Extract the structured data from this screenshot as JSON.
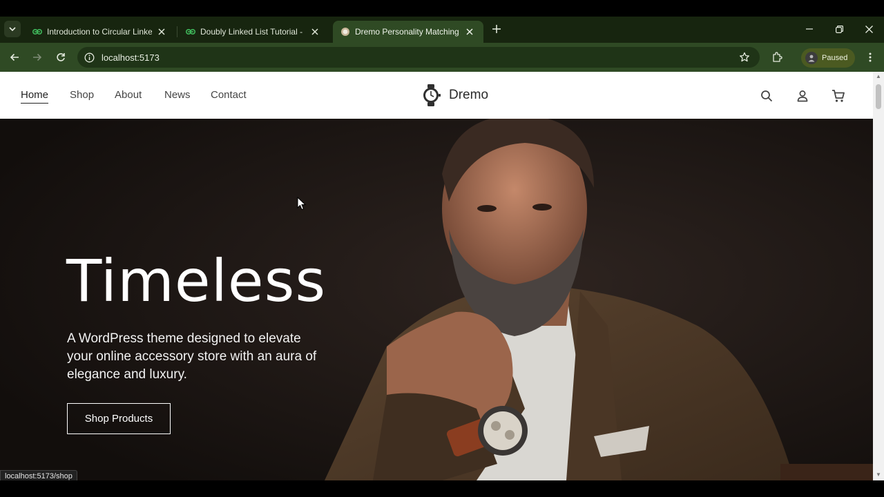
{
  "browser": {
    "tabs": [
      {
        "title": "Introduction to Circular Linked",
        "active": false
      },
      {
        "title": "Doubly Linked List Tutorial - Ge",
        "active": false
      },
      {
        "title": "Dremo Personality Matching W",
        "active": true
      }
    ],
    "url": "localhost:5173",
    "profile_label": "Paused",
    "status_url": "localhost:5173/shop"
  },
  "site": {
    "nav": [
      "Home",
      "Shop",
      "About",
      "News",
      "Contact"
    ],
    "brand_name": "Dremo",
    "hero": {
      "title": "Timeless",
      "subtitle": "A WordPress theme designed to elevate your online accessory store with an aura of elegance and luxury.",
      "cta": "Shop Products"
    }
  },
  "colors": {
    "tabstrip": "#17250f",
    "toolbar": "#2f4a24",
    "hero_bg": "#181311"
  },
  "icons": [
    "tab-list-icon",
    "favicon-gfg-icon",
    "favicon-watch-icon",
    "close-icon",
    "plus-icon",
    "minimize-icon",
    "restore-icon",
    "window-close-icon",
    "back-icon",
    "forward-icon",
    "reload-icon",
    "info-icon",
    "star-icon",
    "extensions-icon",
    "menu-icon",
    "watch-logo-icon",
    "search-icon",
    "user-icon",
    "cart-icon",
    "cursor-icon"
  ]
}
